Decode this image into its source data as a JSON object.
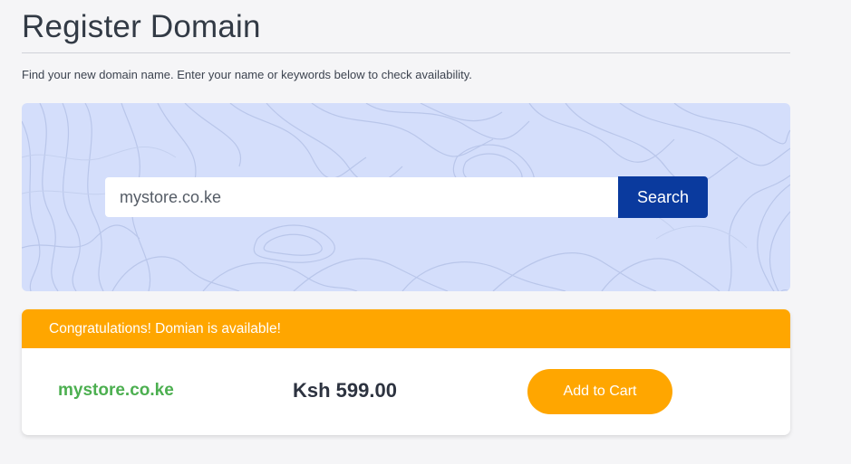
{
  "page": {
    "title": "Register Domain",
    "intro": "Find your new domain name. Enter your name or keywords below to check availability."
  },
  "search": {
    "value": "mystore.co.ke",
    "button_label": "Search"
  },
  "result": {
    "banner": "Congratulations! Domian is available!",
    "domain": "mystore.co.ke",
    "price": "Ksh 599.00",
    "cart_label": "Add to Cart"
  },
  "colors": {
    "accent": "#ffa600",
    "primary": "#0a3a9e",
    "success": "#4caf50",
    "panel_bg": "#d4defb"
  }
}
